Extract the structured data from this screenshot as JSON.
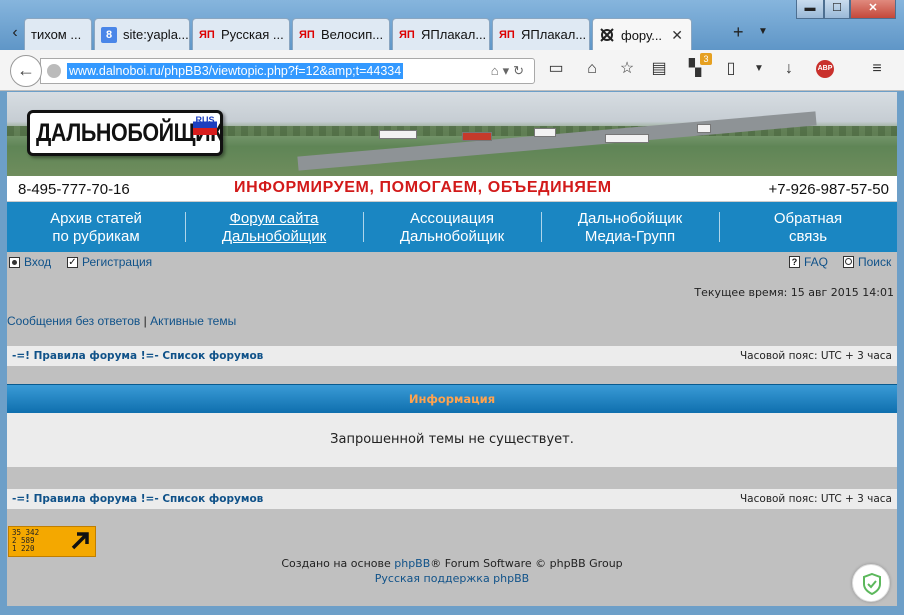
{
  "browser": {
    "tabs": [
      {
        "label": "тихом ...",
        "icon": "none"
      },
      {
        "label": "site:yapla...",
        "icon": "google-icon"
      },
      {
        "label": "Русская ...",
        "icon": "yap-icon"
      },
      {
        "label": "Велосип...",
        "icon": "yap-icon"
      },
      {
        "label": "ЯПлакал...",
        "icon": "yap-icon"
      },
      {
        "label": "ЯПлакал...",
        "icon": "yap-icon"
      },
      {
        "label": "фору...",
        "icon": "forum-icon",
        "active": true
      }
    ],
    "new_tab": "+",
    "google_letter": "8",
    "yap_letters": "ЯП",
    "url": "www.dalnoboi.ru/phpBB3/viewtopic.php?f=12&amp;t=44334",
    "badge_count": "3",
    "abp_label": "ABP",
    "window_controls": {
      "minimize": "▬",
      "maximize": "☐",
      "close": "✕"
    }
  },
  "site": {
    "logo_text": "ДАЛЬНОБОЙЩИК",
    "logo_sub": "RUS",
    "phone_left": "8-495-777-70-16",
    "slogan": "ИНФОРМИРУЕМ, ПОМОГАЕМ, ОБЪЕДИНЯЕМ",
    "phone_right": "+7-926-987-57-50",
    "menu": [
      {
        "label": "Архив статей\nпо рубрикам"
      },
      {
        "label": "Форум сайта\nДальнобойщик",
        "active": true
      },
      {
        "label": "Ассоциация\nДальнобойщик"
      },
      {
        "label": "Дальнобойщик\nМедиа-Групп"
      },
      {
        "label": "Обратная\nсвязь"
      }
    ]
  },
  "forum": {
    "login": "Вход",
    "register": "Регистрация",
    "faq": "FAQ",
    "search": "Поиск",
    "current_time": "Текущее время: 15 авг 2015 14:01",
    "unanswered": "Сообщения без ответов",
    "separator": "|",
    "active_topics": "Активные темы",
    "breadcrumb": "-=! Правила форума !=- Список форумов",
    "timezone": "Часовой пояс: UTC + 3 часа",
    "info_title": "Информация",
    "info_message": "Запрошенной темы не существует.",
    "counter_lines": "35 342\n2 589\n1 220",
    "footer_prefix": "Создано на основе ",
    "footer_link": "phpBB",
    "footer_suffix": "® Forum Software © phpBB Group",
    "footer_support": "Русская поддержка phpBB"
  }
}
